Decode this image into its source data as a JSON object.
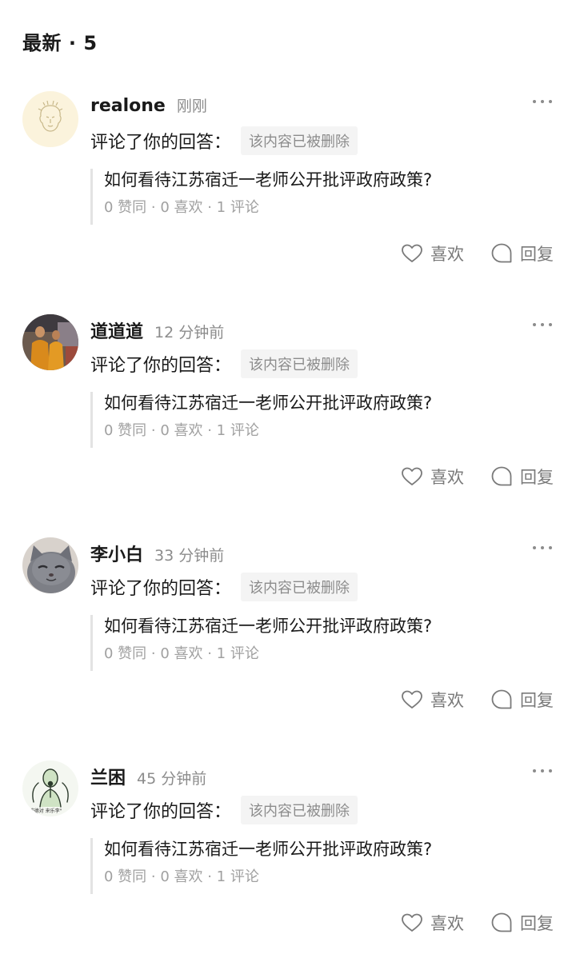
{
  "header": {
    "title": "最新 · 5"
  },
  "comments": [
    {
      "user": "realone",
      "time": "刚刚",
      "action": "评论了你的回答：",
      "badge": "该内容已被删除",
      "question": "如何看待江苏宿迁一老师公开批评政府政策?",
      "stats": "0 赞同 · 0 喜欢 · 1 评论",
      "like_label": "喜欢",
      "reply_label": "回复",
      "avatar": "lion-sketch-avatar"
    },
    {
      "user": "道道道",
      "time": "12 分钟前",
      "action": "评论了你的回答：",
      "badge": "该内容已被删除",
      "question": "如何看待江苏宿迁一老师公开批评政府政策?",
      "stats": "0 赞同 · 0 喜欢 · 1 评论",
      "like_label": "喜欢",
      "reply_label": "回复",
      "avatar": "monks-photo-avatar"
    },
    {
      "user": "李小白",
      "time": "33 分钟前",
      "action": "评论了你的回答：",
      "badge": "该内容已被删除",
      "question": "如何看待江苏宿迁一老师公开批评政府政策?",
      "stats": "0 赞同 · 0 喜欢 · 1 评论",
      "like_label": "喜欢",
      "reply_label": "回复",
      "avatar": "grey-cat-avatar"
    },
    {
      "user": "兰困",
      "time": "45 分钟前",
      "action": "评论了你的回答：",
      "badge": "该内容已被删除",
      "question": "如何看待江苏宿迁一老师公开批评政府政策?",
      "stats": "0 赞同 · 0 喜欢 · 1 评论",
      "like_label": "喜欢",
      "reply_label": "回复",
      "avatar": "singer-sketch-avatar",
      "avatar_caption": "\"唯德对 来乐李\""
    }
  ],
  "icons": {
    "more": "more-dots-icon",
    "like": "heart-icon",
    "reply": "speech-bubble-icon"
  },
  "colors": {
    "text": "#1a1a1a",
    "muted": "#8c8c8c",
    "badge_bg": "#f4f4f4",
    "quote_bar": "#e3e3e3"
  }
}
